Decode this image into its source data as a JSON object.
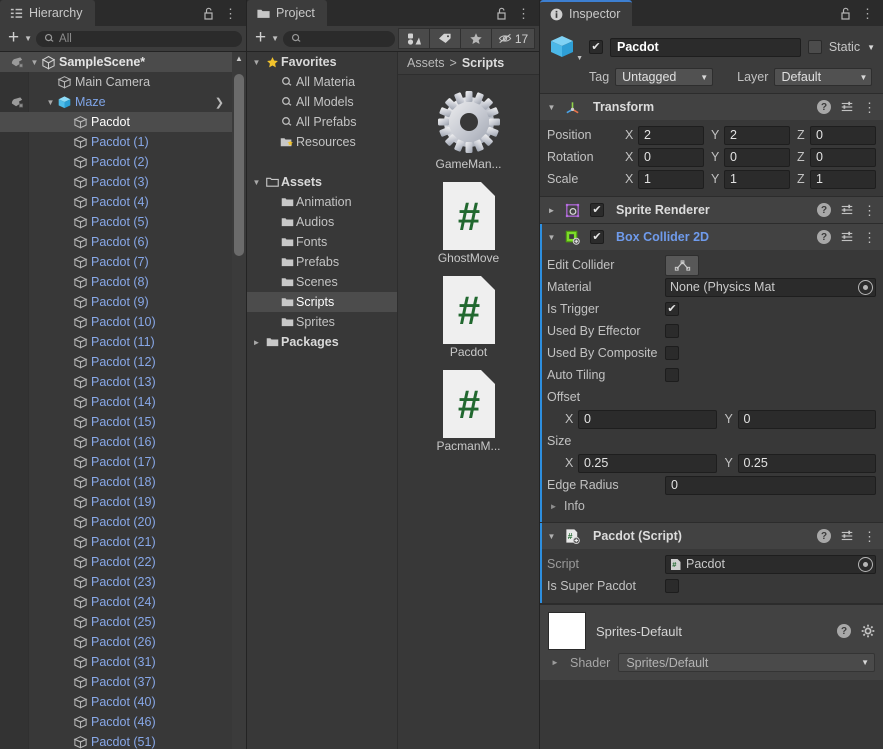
{
  "hierarchy": {
    "tab": "Hierarchy",
    "toolbar": {
      "add_label": "+",
      "search_placeholder": "All"
    },
    "rows": [
      {
        "name": "SampleScene*",
        "indent": 0,
        "icon": "unity-scene-icon",
        "kind": "scene",
        "twisty": "down"
      },
      {
        "name": "Main Camera",
        "indent": 1,
        "icon": "gameobject-cube-icon",
        "kind": "plain",
        "twisty": ""
      },
      {
        "name": "Maze",
        "indent": 1,
        "icon": "prefab-cube-icon",
        "kind": "prefab-root",
        "twisty": "down"
      },
      {
        "name": "Pacdot",
        "indent": 2,
        "icon": "gameobject-cube-icon",
        "kind": "selected",
        "twisty": ""
      },
      {
        "name": "Pacdot (1)",
        "indent": 2,
        "icon": "gameobject-cube-icon",
        "kind": "prefab",
        "twisty": ""
      },
      {
        "name": "Pacdot (2)",
        "indent": 2,
        "icon": "gameobject-cube-icon",
        "kind": "prefab",
        "twisty": ""
      },
      {
        "name": "Pacdot (3)",
        "indent": 2,
        "icon": "gameobject-cube-icon",
        "kind": "prefab",
        "twisty": ""
      },
      {
        "name": "Pacdot (4)",
        "indent": 2,
        "icon": "gameobject-cube-icon",
        "kind": "prefab",
        "twisty": ""
      },
      {
        "name": "Pacdot (5)",
        "indent": 2,
        "icon": "gameobject-cube-icon",
        "kind": "prefab",
        "twisty": ""
      },
      {
        "name": "Pacdot (6)",
        "indent": 2,
        "icon": "gameobject-cube-icon",
        "kind": "prefab",
        "twisty": ""
      },
      {
        "name": "Pacdot (7)",
        "indent": 2,
        "icon": "gameobject-cube-icon",
        "kind": "prefab",
        "twisty": ""
      },
      {
        "name": "Pacdot (8)",
        "indent": 2,
        "icon": "gameobject-cube-icon",
        "kind": "prefab",
        "twisty": ""
      },
      {
        "name": "Pacdot (9)",
        "indent": 2,
        "icon": "gameobject-cube-icon",
        "kind": "prefab",
        "twisty": ""
      },
      {
        "name": "Pacdot (10)",
        "indent": 2,
        "icon": "gameobject-cube-icon",
        "kind": "prefab",
        "twisty": ""
      },
      {
        "name": "Pacdot (11)",
        "indent": 2,
        "icon": "gameobject-cube-icon",
        "kind": "prefab",
        "twisty": ""
      },
      {
        "name": "Pacdot (12)",
        "indent": 2,
        "icon": "gameobject-cube-icon",
        "kind": "prefab",
        "twisty": ""
      },
      {
        "name": "Pacdot (13)",
        "indent": 2,
        "icon": "gameobject-cube-icon",
        "kind": "prefab",
        "twisty": ""
      },
      {
        "name": "Pacdot (14)",
        "indent": 2,
        "icon": "gameobject-cube-icon",
        "kind": "prefab",
        "twisty": ""
      },
      {
        "name": "Pacdot (15)",
        "indent": 2,
        "icon": "gameobject-cube-icon",
        "kind": "prefab",
        "twisty": ""
      },
      {
        "name": "Pacdot (16)",
        "indent": 2,
        "icon": "gameobject-cube-icon",
        "kind": "prefab",
        "twisty": ""
      },
      {
        "name": "Pacdot (17)",
        "indent": 2,
        "icon": "gameobject-cube-icon",
        "kind": "prefab",
        "twisty": ""
      },
      {
        "name": "Pacdot (18)",
        "indent": 2,
        "icon": "gameobject-cube-icon",
        "kind": "prefab",
        "twisty": ""
      },
      {
        "name": "Pacdot (19)",
        "indent": 2,
        "icon": "gameobject-cube-icon",
        "kind": "prefab",
        "twisty": ""
      },
      {
        "name": "Pacdot (20)",
        "indent": 2,
        "icon": "gameobject-cube-icon",
        "kind": "prefab",
        "twisty": ""
      },
      {
        "name": "Pacdot (21)",
        "indent": 2,
        "icon": "gameobject-cube-icon",
        "kind": "prefab",
        "twisty": ""
      },
      {
        "name": "Pacdot (22)",
        "indent": 2,
        "icon": "gameobject-cube-icon",
        "kind": "prefab",
        "twisty": ""
      },
      {
        "name": "Pacdot (23)",
        "indent": 2,
        "icon": "gameobject-cube-icon",
        "kind": "prefab",
        "twisty": ""
      },
      {
        "name": "Pacdot (24)",
        "indent": 2,
        "icon": "gameobject-cube-icon",
        "kind": "prefab",
        "twisty": ""
      },
      {
        "name": "Pacdot (25)",
        "indent": 2,
        "icon": "gameobject-cube-icon",
        "kind": "prefab",
        "twisty": ""
      },
      {
        "name": "Pacdot (26)",
        "indent": 2,
        "icon": "gameobject-cube-icon",
        "kind": "prefab",
        "twisty": ""
      },
      {
        "name": "Pacdot (31)",
        "indent": 2,
        "icon": "gameobject-cube-icon",
        "kind": "prefab",
        "twisty": ""
      },
      {
        "name": "Pacdot (37)",
        "indent": 2,
        "icon": "gameobject-cube-icon",
        "kind": "prefab",
        "twisty": ""
      },
      {
        "name": "Pacdot (40)",
        "indent": 2,
        "icon": "gameobject-cube-icon",
        "kind": "prefab",
        "twisty": ""
      },
      {
        "name": "Pacdot (46)",
        "indent": 2,
        "icon": "gameobject-cube-icon",
        "kind": "prefab",
        "twisty": ""
      },
      {
        "name": "Pacdot (51)",
        "indent": 2,
        "icon": "gameobject-cube-icon",
        "kind": "prefab",
        "twisty": ""
      }
    ]
  },
  "project": {
    "tab": "Project",
    "toolbar": {
      "add_label": "+",
      "search_placeholder": "",
      "hidden_count": "17"
    },
    "tree": [
      {
        "label": "Favorites",
        "indent": 0,
        "icon": "star-icon",
        "twisty": "down",
        "bold": true,
        "selected": false
      },
      {
        "label": "All Materia",
        "indent": 1,
        "icon": "search-icon",
        "twisty": "",
        "bold": false,
        "selected": false
      },
      {
        "label": "All Models",
        "indent": 1,
        "icon": "search-icon",
        "twisty": "",
        "bold": false,
        "selected": false
      },
      {
        "label": "All Prefabs",
        "indent": 1,
        "icon": "search-icon",
        "twisty": "",
        "bold": false,
        "selected": false
      },
      {
        "label": "Resources",
        "indent": 1,
        "icon": "folder-star-icon",
        "twisty": "",
        "bold": false,
        "selected": false
      },
      {
        "label": "",
        "indent": 0,
        "icon": "",
        "twisty": "",
        "bold": false,
        "selected": false
      },
      {
        "label": "Assets",
        "indent": 0,
        "icon": "folder-open-icon",
        "twisty": "down",
        "bold": true,
        "selected": false
      },
      {
        "label": "Animation",
        "indent": 1,
        "icon": "folder-icon",
        "twisty": "",
        "bold": false,
        "selected": false
      },
      {
        "label": "Audios",
        "indent": 1,
        "icon": "folder-icon",
        "twisty": "",
        "bold": false,
        "selected": false
      },
      {
        "label": "Fonts",
        "indent": 1,
        "icon": "folder-icon",
        "twisty": "",
        "bold": false,
        "selected": false
      },
      {
        "label": "Prefabs",
        "indent": 1,
        "icon": "folder-icon",
        "twisty": "",
        "bold": false,
        "selected": false
      },
      {
        "label": "Scenes",
        "indent": 1,
        "icon": "folder-icon",
        "twisty": "",
        "bold": false,
        "selected": false
      },
      {
        "label": "Scripts",
        "indent": 1,
        "icon": "folder-icon",
        "twisty": "",
        "bold": false,
        "selected": true
      },
      {
        "label": "Sprites",
        "indent": 1,
        "icon": "folder-icon",
        "twisty": "",
        "bold": false,
        "selected": false
      },
      {
        "label": "Packages",
        "indent": 0,
        "icon": "folder-icon",
        "twisty": "right",
        "bold": true,
        "selected": false
      }
    ],
    "breadcrumb": {
      "root": "Assets",
      "separator": ">",
      "current": "Scripts"
    },
    "assets": [
      {
        "name": "GameMan...",
        "icon": "gear-asset-icon"
      },
      {
        "name": "GhostMove",
        "icon": "csharp-script-icon"
      },
      {
        "name": "Pacdot",
        "icon": "csharp-script-icon"
      },
      {
        "name": "PacmanM...",
        "icon": "csharp-script-icon"
      }
    ]
  },
  "inspector": {
    "tab": "Inspector",
    "gameobject": {
      "enabled": true,
      "name": "Pacdot",
      "static_label": "Static",
      "static_checked": false,
      "tag_label": "Tag",
      "tag_value": "Untagged",
      "layer_label": "Layer",
      "layer_value": "Default"
    },
    "transform": {
      "title": "Transform",
      "rows": [
        {
          "label": "Position",
          "x": "2",
          "y": "2",
          "z": "0"
        },
        {
          "label": "Rotation",
          "x": "0",
          "y": "0",
          "z": "0"
        },
        {
          "label": "Scale",
          "x": "1",
          "y": "1",
          "z": "1"
        }
      ],
      "axis_x": "X",
      "axis_y": "Y",
      "axis_z": "Z"
    },
    "sprite_renderer": {
      "title": "Sprite Renderer",
      "enabled": true,
      "expanded": false
    },
    "box_collider": {
      "title": "Box Collider 2D",
      "enabled": true,
      "expanded": true,
      "edit_collider_label": "Edit Collider",
      "material_label": "Material",
      "material_value": "None (Physics Mat",
      "is_trigger_label": "Is Trigger",
      "is_trigger": true,
      "used_by_effector_label": "Used By Effector",
      "used_by_effector": false,
      "used_by_composite_label": "Used By Composite",
      "used_by_composite": false,
      "auto_tiling_label": "Auto Tiling",
      "auto_tiling": false,
      "offset_label": "Offset",
      "offset_x": "0",
      "offset_y": "0",
      "size_label": "Size",
      "size_x": "0.25",
      "size_y": "0.25",
      "edge_radius_label": "Edge Radius",
      "edge_radius": "0",
      "info_label": "Info",
      "axis_x": "X",
      "axis_y": "Y"
    },
    "script_component": {
      "title": "Pacdot (Script)",
      "script_label": "Script",
      "script_value": "Pacdot",
      "is_super_label": "Is Super Pacdot",
      "is_super": false
    },
    "material_footer": {
      "name": "Sprites-Default",
      "shader_label": "Shader",
      "shader_value": "Sprites/Default"
    }
  },
  "colors": {
    "accent_blue": "#2d8fe0",
    "prefab_blue": "#88a8e8",
    "panel_bg": "#383838",
    "header_bg": "#424242",
    "selection": "#4c4c4c",
    "script_green": "#21682f"
  }
}
